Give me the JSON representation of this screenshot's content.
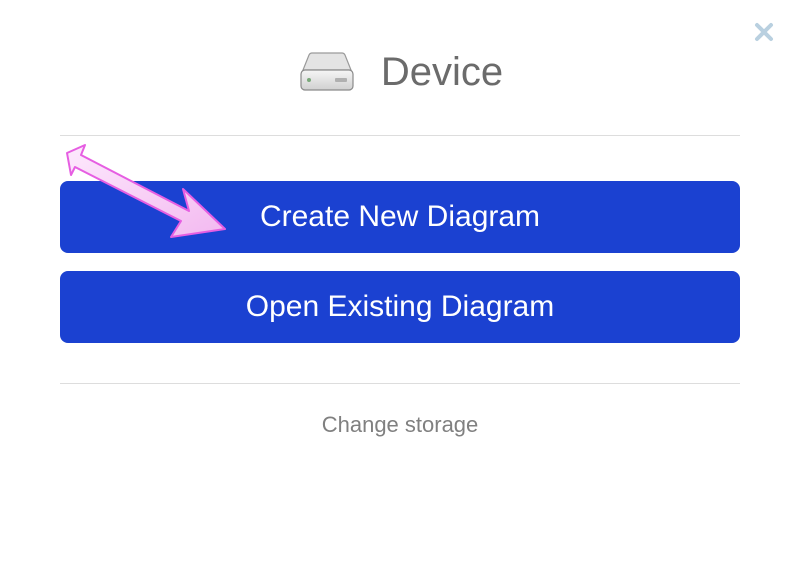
{
  "dialog": {
    "title": "Device",
    "close_icon": "close",
    "device_icon": "hard-drive"
  },
  "actions": {
    "create_label": "Create New Diagram",
    "open_label": "Open Existing Diagram"
  },
  "footer": {
    "change_storage_label": "Change storage"
  },
  "colors": {
    "primary": "#1b41d1",
    "text_muted": "#6b6b6b",
    "divider": "#dddddd",
    "close_icon": "#b9d0e0"
  }
}
